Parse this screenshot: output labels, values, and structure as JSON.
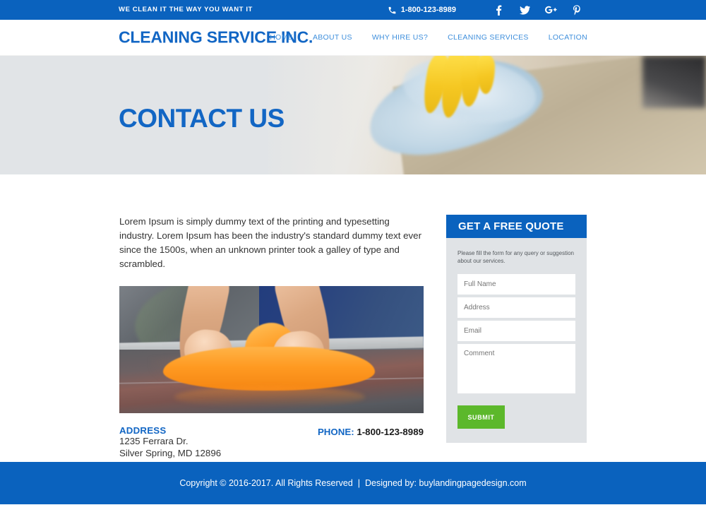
{
  "topbar": {
    "tagline": "WE CLEAN IT THE WAY YOU WANT IT",
    "phone": "1-800-123-8989",
    "phone_icon": "phone-icon",
    "social": [
      {
        "name": "facebook",
        "label": "f"
      },
      {
        "name": "twitter",
        "label": "t"
      },
      {
        "name": "google-plus",
        "label": "G+"
      },
      {
        "name": "pinterest",
        "label": "P"
      }
    ]
  },
  "header": {
    "logo": "CLEANING SERVICE INC.",
    "nav": [
      {
        "label": "HOME"
      },
      {
        "label": "ABOUT US"
      },
      {
        "label": "WHY HIRE US?"
      },
      {
        "label": "CLEANING SERVICES"
      },
      {
        "label": "LOCATION"
      }
    ]
  },
  "hero": {
    "title": "CONTACT US",
    "image_alt": "yellow-gloved-hand-wiping-countertop-with-blue-cloth"
  },
  "main": {
    "lead_text": "Lorem Ipsum is simply dummy text of the printing and typesetting industry. Lorem Ipsum has been the industry's standard dummy text ever since the 1500s, when an unknown printer took a galley of type and scrambled.",
    "image_alt": "two-hands-wiping-tiled-floor-with-orange-cloth",
    "address_label": "ADDRESS",
    "address_line1": "1235 Ferrara Dr.",
    "address_line2": "Silver Spring, MD 12896",
    "phone_label": "PHONE:",
    "phone_number": "1-800-123-8989"
  },
  "quote_form": {
    "heading": "GET A FREE QUOTE",
    "description": "Please fill the form for any query or suggestion about our services.",
    "fields": [
      {
        "name": "full-name",
        "placeholder": "Full Name",
        "value": ""
      },
      {
        "name": "address",
        "placeholder": "Address",
        "value": ""
      },
      {
        "name": "email",
        "placeholder": "Email",
        "value": ""
      }
    ],
    "comment_placeholder": "Comment",
    "comment_value": "",
    "submit_label": "SUBMIT"
  },
  "footer": {
    "copyright": "Copyright © 2016-2017. All Rights Reserved",
    "separator": "|",
    "designed_by": "Designed by: buylandingpagedesign.com"
  },
  "colors": {
    "brand_blue": "#0a62be",
    "link_blue": "#3f8fdc",
    "heading_blue": "#1266c4",
    "submit_green": "#5cb82b",
    "panel_gray": "#e0e3e6",
    "hero_gray": "#e1e4e7"
  }
}
